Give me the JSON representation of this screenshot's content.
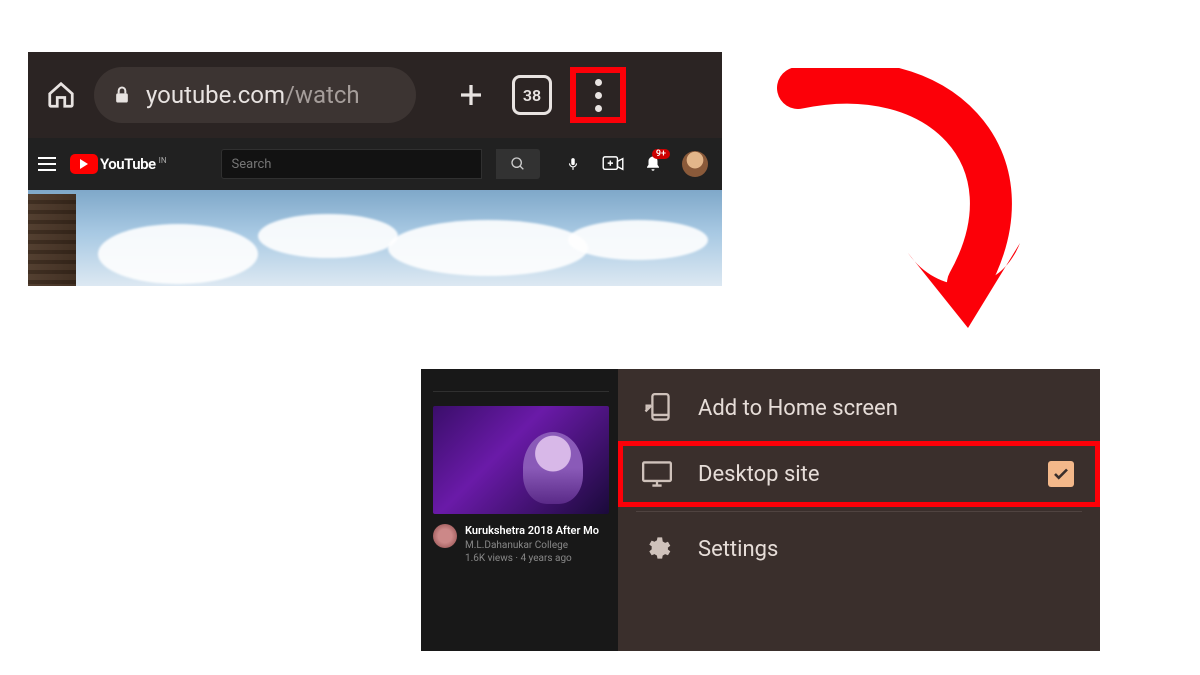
{
  "browser": {
    "url_host": "youtube.com",
    "url_path": "/watch",
    "tab_count": "38"
  },
  "youtube": {
    "brand": "YouTube",
    "region": "IN",
    "search_placeholder": "Search",
    "notification_badge": "9+"
  },
  "sidebar_video": {
    "title": "Kurukshetra 2018 After Mo",
    "channel": "M.L.Dahanukar College",
    "stats": "1.6K views · 4 years ago"
  },
  "menu": {
    "add_home": "Add to Home screen",
    "desktop_site": "Desktop site",
    "desktop_site_checked": true,
    "settings": "Settings"
  },
  "highlight_color": "#fc0008"
}
